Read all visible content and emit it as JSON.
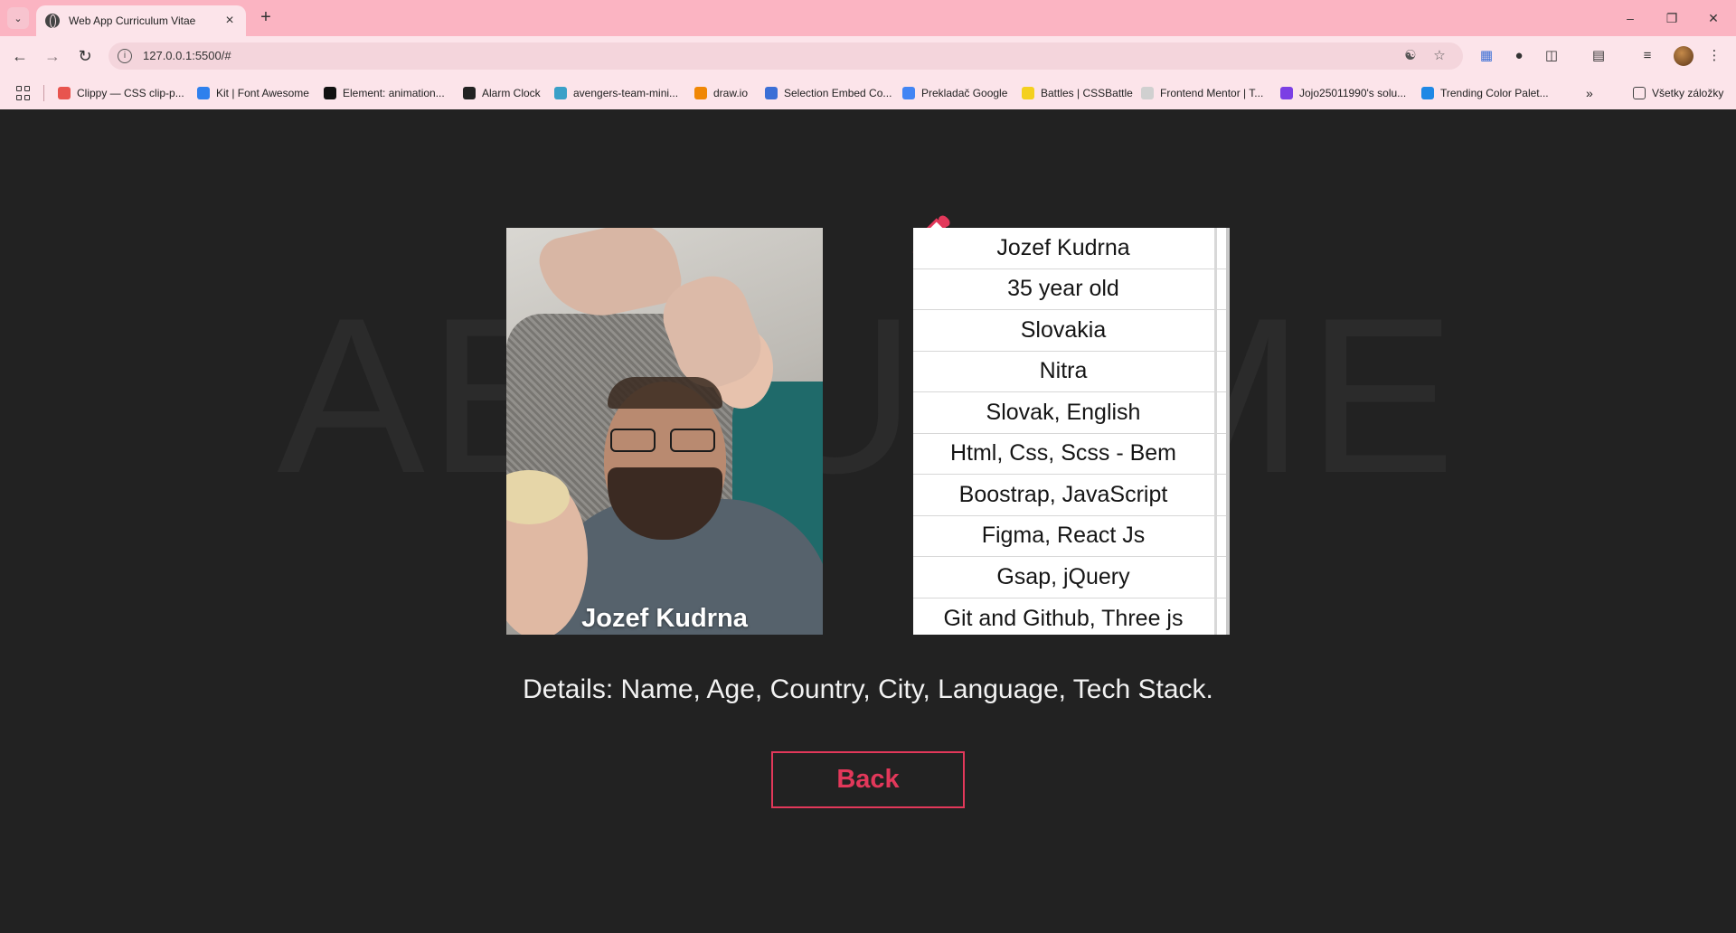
{
  "browser": {
    "tab_title": "Web App Curriculum Vitae",
    "url": "127.0.0.1:5500/#",
    "bookmarks": [
      {
        "label": "Clippy — CSS clip-p...",
        "color": "#e8544e"
      },
      {
        "label": "Kit | Font Awesome",
        "color": "#2f80ed"
      },
      {
        "label": "Element: animation...",
        "color": "#111111"
      },
      {
        "label": "Alarm Clock",
        "color": "#222222"
      },
      {
        "label": "avengers-team-mini...",
        "color": "#3aa0c8"
      },
      {
        "label": "draw.io",
        "color": "#f08705"
      },
      {
        "label": "Selection Embed Co...",
        "color": "#3b6fd6"
      },
      {
        "label": "Prekladač Google",
        "color": "#4285f4"
      },
      {
        "label": "Battles | CSSBattle",
        "color": "#f4d01e"
      },
      {
        "label": "Frontend Mentor | T...",
        "color": "#d0d0d0"
      },
      {
        "label": "Jojo25011990's solu...",
        "color": "#7b3fe4"
      },
      {
        "label": "Trending Color Palet...",
        "color": "#1e88e5"
      }
    ],
    "all_bookmarks_label": "Všetky záložky"
  },
  "page": {
    "background_word": "ABOUT ME",
    "photo_caption": "Jozef Kudrna",
    "details": [
      "Jozef Kudrna",
      "35 year old",
      "Slovakia",
      "Nitra",
      "Slovak, English",
      "Html, Css, Scss - Bem",
      "Boostrap, JavaScript",
      "Figma, React Js",
      "Gsap, jQuery",
      "Git and Github, Three js"
    ],
    "summary": "Details: Name, Age, Country, City, Language, Tech Stack.",
    "back_label": "Back",
    "accent_color": "#e2385a"
  }
}
